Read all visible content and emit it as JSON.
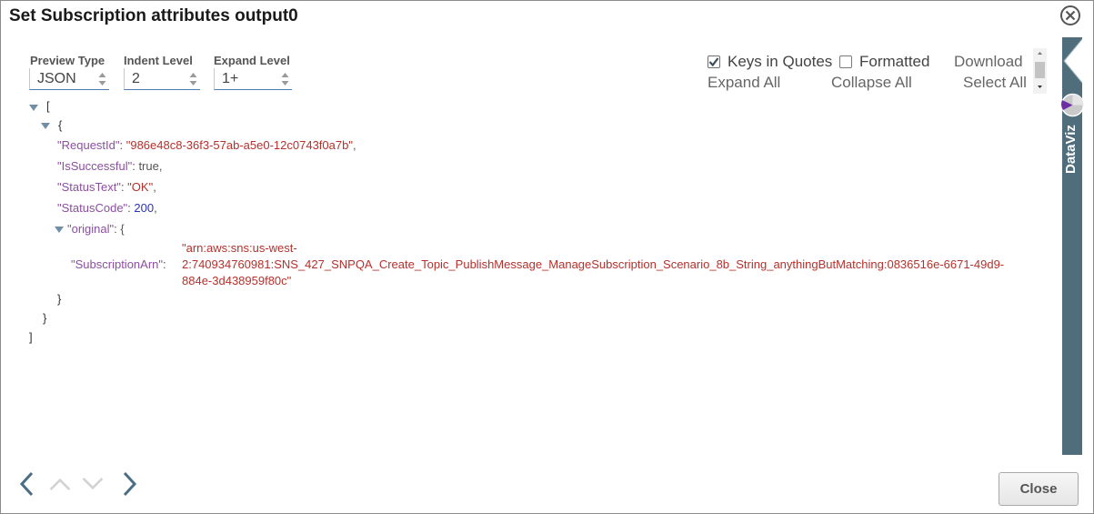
{
  "dialog": {
    "title": "Set Subscription attributes output0",
    "close_icon": "close-circle-icon"
  },
  "controls": {
    "preview_type": {
      "label": "Preview Type",
      "value": "JSON"
    },
    "indent_level": {
      "label": "Indent Level",
      "value": "2"
    },
    "expand_level": {
      "label": "Expand Level",
      "value": "1+"
    }
  },
  "options": {
    "keys_in_quotes": {
      "label": "Keys in Quotes",
      "checked": true
    },
    "formatted": {
      "label": "Formatted",
      "checked": false
    },
    "download": "Download",
    "expand_all": "Expand All",
    "collapse_all": "Collapse All",
    "select_all": "Select All"
  },
  "json_view": {
    "open_array": "[",
    "open_object": "{",
    "fields": [
      {
        "key": "\"RequestId\"",
        "value": "\"986e48c8-36f3-57ab-a5e0-12c0743f0a7b\"",
        "type": "string"
      },
      {
        "key": "\"IsSuccessful\"",
        "value": "true",
        "type": "bool"
      },
      {
        "key": "\"StatusText\"",
        "value": "\"OK\"",
        "type": "string"
      },
      {
        "key": "\"StatusCode\"",
        "value": "200",
        "type": "number"
      }
    ],
    "original": {
      "key": "\"original\"",
      "open": "{",
      "sub_key": "\"SubscriptionArn\"",
      "sub_value_lines": [
        "\"arn:aws:sns:us-west-",
        "2:740934760981:SNS_427_SNPQA_Create_Topic_PublishMessage_ManageSubscription_Scenario_8b_String_anythingButMatching:0836516e-6671-49d9-",
        "884e-3d438959f80c\""
      ],
      "close": "}"
    },
    "close_object": "}",
    "close_array": "]",
    "colors": {
      "key": "#8c4fa0",
      "string": "#b5312b",
      "number": "#2a33b8",
      "bool": "#555555"
    }
  },
  "side_panel": {
    "label": "DataViz",
    "icon": "pie-chart-icon",
    "color": "#4f6d7a"
  },
  "footer": {
    "prev_icon": "chevron-left-icon",
    "up_icon": "chevron-up-icon",
    "down_icon": "chevron-down-icon",
    "next_icon": "chevron-right-icon",
    "close_label": "Close"
  }
}
